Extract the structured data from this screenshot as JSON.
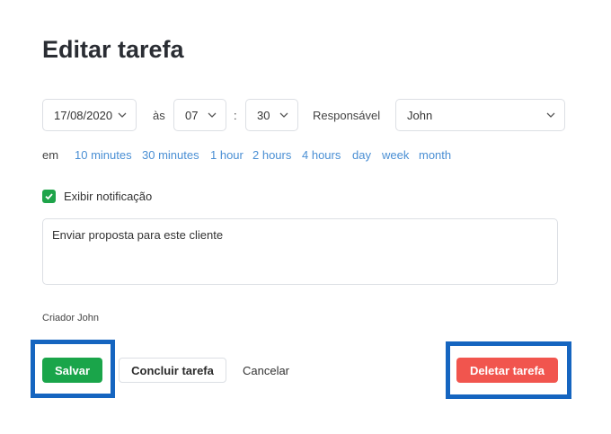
{
  "title": "Editar tarefa",
  "schedule": {
    "date": "17/08/2020",
    "at_label": "às",
    "hour": "07",
    "colon": ":",
    "minute": "30",
    "responsible_label": "Responsável",
    "responsible": "John"
  },
  "quick": {
    "prefix": "em",
    "options": [
      "10 minutes",
      "30 minutes",
      "1 hour",
      "2 hours",
      "4 hours",
      "day",
      "week",
      "month"
    ]
  },
  "notification": {
    "label": "Exibir notificação",
    "checked": true
  },
  "description": "Enviar proposta para este cliente",
  "creator": "Criador John",
  "buttons": {
    "save": "Salvar",
    "complete": "Concluir tarefa",
    "cancel": "Cancelar",
    "delete": "Deletar tarefa"
  },
  "colors": {
    "save": "#1aa54a",
    "delete": "#f1554e",
    "link": "#4a8fd4",
    "highlight": "#1565c0"
  }
}
